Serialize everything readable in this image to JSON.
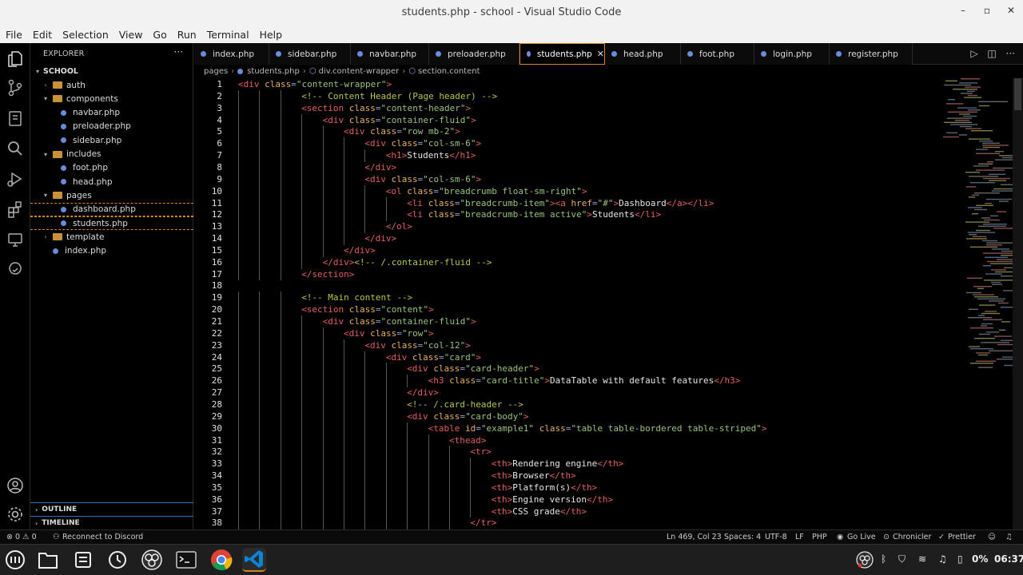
{
  "window": {
    "title": "students.php - school - Visual Studio Code",
    "minimize": "–",
    "maximize": "▫",
    "close": "✕"
  },
  "menu": [
    "File",
    "Edit",
    "Selection",
    "View",
    "Go",
    "Run",
    "Terminal",
    "Help"
  ],
  "sidebar": {
    "header": "EXPLORER",
    "more": "···",
    "root": "SCHOOL",
    "items": [
      {
        "label": "auth",
        "type": "folder",
        "depth": 1,
        "open": false
      },
      {
        "label": "components",
        "type": "folder",
        "depth": 1,
        "open": true
      },
      {
        "label": "navbar.php",
        "type": "file",
        "depth": 2
      },
      {
        "label": "preloader.php",
        "type": "file",
        "depth": 2
      },
      {
        "label": "sidebar.php",
        "type": "file",
        "depth": 2
      },
      {
        "label": "includes",
        "type": "folder",
        "depth": 1,
        "open": true
      },
      {
        "label": "foot.php",
        "type": "file",
        "depth": 2
      },
      {
        "label": "head.php",
        "type": "file",
        "depth": 2
      },
      {
        "label": "pages",
        "type": "folder",
        "depth": 1,
        "open": true
      },
      {
        "label": "dashboard.php",
        "type": "file",
        "depth": 2,
        "selected": true
      },
      {
        "label": "students.php",
        "type": "file",
        "depth": 2,
        "selected": true
      },
      {
        "label": "template",
        "type": "folder",
        "depth": 1,
        "open": false
      },
      {
        "label": "index.php",
        "type": "file",
        "depth": 1
      }
    ],
    "outline": "OUTLINE",
    "timeline": "TIMELINE"
  },
  "tabs": [
    {
      "label": "index.php"
    },
    {
      "label": "sidebar.php"
    },
    {
      "label": "navbar.php"
    },
    {
      "label": "preloader.php"
    },
    {
      "label": "students.php",
      "active": true
    },
    {
      "label": "head.php"
    },
    {
      "label": "foot.php"
    },
    {
      "label": "login.php"
    },
    {
      "label": "register.php"
    }
  ],
  "tab_close": "✕",
  "breadcrumb": [
    "pages",
    "students.php",
    "div.content-wrapper",
    "section.content"
  ],
  "editor": {
    "line_numbers": [
      1,
      2,
      3,
      4,
      5,
      6,
      7,
      8,
      9,
      10,
      11,
      12,
      13,
      14,
      15,
      16,
      17,
      18,
      19,
      20,
      21,
      22,
      23,
      24,
      25,
      26,
      27,
      28,
      29,
      30,
      31,
      32,
      33,
      34,
      35,
      36,
      37,
      38
    ],
    "lines": [
      {
        "indent": 0,
        "parts": [
          [
            "tag",
            "<div "
          ],
          [
            "attr",
            "class"
          ],
          [
            "pun",
            "="
          ],
          [
            "str",
            "\"content-wrapper\""
          ],
          [
            "tag",
            ">"
          ]
        ]
      },
      {
        "indent": 3,
        "parts": [
          [
            "cmt",
            "<!-- Content Header (Page header) -->"
          ]
        ]
      },
      {
        "indent": 3,
        "parts": [
          [
            "tag",
            "<section "
          ],
          [
            "attr",
            "class"
          ],
          [
            "pun",
            "="
          ],
          [
            "str",
            "\"content-header\""
          ],
          [
            "tag",
            ">"
          ]
        ]
      },
      {
        "indent": 4,
        "parts": [
          [
            "tag",
            "<div "
          ],
          [
            "attr",
            "class"
          ],
          [
            "pun",
            "="
          ],
          [
            "str",
            "\"container-fluid\""
          ],
          [
            "tag",
            ">"
          ]
        ]
      },
      {
        "indent": 5,
        "parts": [
          [
            "tag",
            "<div "
          ],
          [
            "attr",
            "class"
          ],
          [
            "pun",
            "="
          ],
          [
            "str",
            "\"row mb-2\""
          ],
          [
            "tag",
            ">"
          ]
        ]
      },
      {
        "indent": 6,
        "parts": [
          [
            "tag",
            "<div "
          ],
          [
            "attr",
            "class"
          ],
          [
            "pun",
            "="
          ],
          [
            "str",
            "\"col-sm-6\""
          ],
          [
            "tag",
            ">"
          ]
        ]
      },
      {
        "indent": 7,
        "parts": [
          [
            "tag",
            "<h1>"
          ],
          [
            "txt",
            "Students"
          ],
          [
            "tag",
            "</h1>"
          ]
        ]
      },
      {
        "indent": 6,
        "parts": [
          [
            "tag",
            "</div>"
          ]
        ]
      },
      {
        "indent": 6,
        "parts": [
          [
            "tag",
            "<div "
          ],
          [
            "attr",
            "class"
          ],
          [
            "pun",
            "="
          ],
          [
            "str",
            "\"col-sm-6\""
          ],
          [
            "tag",
            ">"
          ]
        ]
      },
      {
        "indent": 7,
        "parts": [
          [
            "tag",
            "<ol "
          ],
          [
            "attr",
            "class"
          ],
          [
            "pun",
            "="
          ],
          [
            "str",
            "\"breadcrumb float-sm-right\""
          ],
          [
            "tag",
            ">"
          ]
        ]
      },
      {
        "indent": 8,
        "parts": [
          [
            "tag",
            "<li "
          ],
          [
            "attr",
            "class"
          ],
          [
            "pun",
            "="
          ],
          [
            "str",
            "\"breadcrumb-item\""
          ],
          [
            "tag",
            "><a "
          ],
          [
            "attr",
            "href"
          ],
          [
            "pun",
            "="
          ],
          [
            "str",
            "\"#\""
          ],
          [
            "tag",
            ">"
          ],
          [
            "txt",
            "Dashboard"
          ],
          [
            "tag",
            "</a></li>"
          ]
        ]
      },
      {
        "indent": 8,
        "parts": [
          [
            "tag",
            "<li "
          ],
          [
            "attr",
            "class"
          ],
          [
            "pun",
            "="
          ],
          [
            "str",
            "\"breadcrumb-item active\""
          ],
          [
            "tag",
            ">"
          ],
          [
            "txt",
            "Students"
          ],
          [
            "tag",
            "</li>"
          ]
        ]
      },
      {
        "indent": 7,
        "parts": [
          [
            "tag",
            "</ol>"
          ]
        ]
      },
      {
        "indent": 6,
        "parts": [
          [
            "tag",
            "</div>"
          ]
        ]
      },
      {
        "indent": 5,
        "parts": [
          [
            "tag",
            "</div>"
          ]
        ]
      },
      {
        "indent": 4,
        "parts": [
          [
            "tag",
            "</div>"
          ],
          [
            "cmt",
            "<!-- /.container-fluid -->"
          ]
        ]
      },
      {
        "indent": 3,
        "parts": [
          [
            "tag",
            "</section>"
          ]
        ]
      },
      {
        "indent": 0,
        "parts": []
      },
      {
        "indent": 3,
        "parts": [
          [
            "cmt",
            "<!-- Main content -->"
          ]
        ]
      },
      {
        "indent": 3,
        "parts": [
          [
            "tag",
            "<section "
          ],
          [
            "attr",
            "class"
          ],
          [
            "pun",
            "="
          ],
          [
            "str",
            "\"content\""
          ],
          [
            "tag",
            ">"
          ]
        ]
      },
      {
        "indent": 4,
        "parts": [
          [
            "tag",
            "<div "
          ],
          [
            "attr",
            "class"
          ],
          [
            "pun",
            "="
          ],
          [
            "str",
            "\"container-fluid\""
          ],
          [
            "tag",
            ">"
          ]
        ]
      },
      {
        "indent": 5,
        "parts": [
          [
            "tag",
            "<div "
          ],
          [
            "attr",
            "class"
          ],
          [
            "pun",
            "="
          ],
          [
            "str",
            "\"row\""
          ],
          [
            "tag",
            ">"
          ]
        ]
      },
      {
        "indent": 6,
        "parts": [
          [
            "tag",
            "<div "
          ],
          [
            "attr",
            "class"
          ],
          [
            "pun",
            "="
          ],
          [
            "str",
            "\"col-12\""
          ],
          [
            "tag",
            ">"
          ]
        ]
      },
      {
        "indent": 7,
        "parts": [
          [
            "tag",
            "<div "
          ],
          [
            "attr",
            "class"
          ],
          [
            "pun",
            "="
          ],
          [
            "str",
            "\"card\""
          ],
          [
            "tag",
            ">"
          ]
        ]
      },
      {
        "indent": 8,
        "parts": [
          [
            "tag",
            "<div "
          ],
          [
            "attr",
            "class"
          ],
          [
            "pun",
            "="
          ],
          [
            "str",
            "\"card-header\""
          ],
          [
            "tag",
            ">"
          ]
        ]
      },
      {
        "indent": 9,
        "parts": [
          [
            "tag",
            "<h3 "
          ],
          [
            "attr",
            "class"
          ],
          [
            "pun",
            "="
          ],
          [
            "str",
            "\"card-title\""
          ],
          [
            "tag",
            ">"
          ],
          [
            "txt",
            "DataTable with default features"
          ],
          [
            "tag",
            "</h3>"
          ]
        ]
      },
      {
        "indent": 8,
        "parts": [
          [
            "tag",
            "</div>"
          ]
        ]
      },
      {
        "indent": 8,
        "parts": [
          [
            "cmt",
            "<!-- /.card-header -->"
          ]
        ]
      },
      {
        "indent": 8,
        "parts": [
          [
            "tag",
            "<div "
          ],
          [
            "attr",
            "class"
          ],
          [
            "pun",
            "="
          ],
          [
            "str",
            "\"card-body\""
          ],
          [
            "tag",
            ">"
          ]
        ]
      },
      {
        "indent": 9,
        "parts": [
          [
            "tag",
            "<table "
          ],
          [
            "attr",
            "id"
          ],
          [
            "pun",
            "="
          ],
          [
            "str",
            "\"example1\""
          ],
          [
            "txt",
            " "
          ],
          [
            "attr",
            "class"
          ],
          [
            "pun",
            "="
          ],
          [
            "str",
            "\"table table-bordered table-striped\""
          ],
          [
            "tag",
            ">"
          ]
        ]
      },
      {
        "indent": 10,
        "parts": [
          [
            "tag",
            "<thead>"
          ]
        ]
      },
      {
        "indent": 11,
        "parts": [
          [
            "tag",
            "<tr>"
          ]
        ]
      },
      {
        "indent": 12,
        "parts": [
          [
            "tag",
            "<th>"
          ],
          [
            "txt",
            "Rendering engine"
          ],
          [
            "tag",
            "</th>"
          ]
        ]
      },
      {
        "indent": 12,
        "parts": [
          [
            "tag",
            "<th>"
          ],
          [
            "txt",
            "Browser"
          ],
          [
            "tag",
            "</th>"
          ]
        ]
      },
      {
        "indent": 12,
        "parts": [
          [
            "tag",
            "<th>"
          ],
          [
            "txt",
            "Platform(s)"
          ],
          [
            "tag",
            "</th>"
          ]
        ]
      },
      {
        "indent": 12,
        "parts": [
          [
            "tag",
            "<th>"
          ],
          [
            "txt",
            "Engine version"
          ],
          [
            "tag",
            "</th>"
          ]
        ]
      },
      {
        "indent": 12,
        "parts": [
          [
            "tag",
            "<th>"
          ],
          [
            "txt",
            "CSS grade"
          ],
          [
            "tag",
            "</th>"
          ]
        ]
      },
      {
        "indent": 11,
        "parts": [
          [
            "tag",
            "</tr>"
          ]
        ]
      }
    ]
  },
  "statusbar": {
    "problems": "⊗ 0 ⚠ 0",
    "discord": "Reconnect to Discord",
    "position": "Ln 469, Col 23",
    "spaces": "Spaces: 4",
    "encoding": "UTF-8",
    "eol": "LF",
    "language": "PHP",
    "golive": "Go Live",
    "chronicler": "Chronicler",
    "prettier": "Prettier"
  },
  "taskbar": {
    "battery": "0%",
    "time": "06:37"
  },
  "colors": {
    "accent_border": "#d2862a",
    "folder": "#c8913a",
    "file_dot": "#6a8cd8",
    "panel_border": "#2f6fb5"
  }
}
